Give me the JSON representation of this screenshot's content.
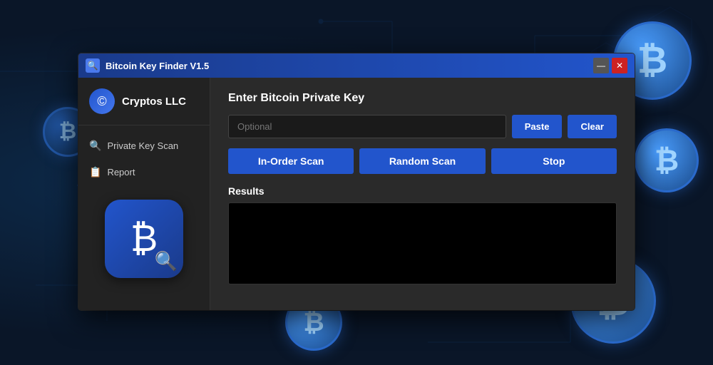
{
  "background": {
    "color": "#0a1628"
  },
  "title_bar": {
    "icon": "🔍",
    "title": "Bitcoin Key Finder V1.5",
    "minimize_label": "—",
    "close_label": "✕"
  },
  "sidebar": {
    "logo_text": "Cryptos LLC",
    "logo_icon": "©",
    "items": [
      {
        "id": "private-key-scan",
        "icon": "🔍",
        "label": "Private Key Scan"
      },
      {
        "id": "report",
        "icon": "📋",
        "label": "Report"
      }
    ]
  },
  "main": {
    "enter_key_title": "Enter Bitcoin Private Key",
    "input_placeholder": "Optional",
    "paste_label": "Paste",
    "clear_label": "Clear",
    "in_order_scan_label": "In-Order Scan",
    "random_scan_label": "Random Scan",
    "stop_label": "Stop",
    "results_title": "Results"
  },
  "coins": [
    {
      "id": "top-right",
      "symbol": "₿"
    },
    {
      "id": "mid-right",
      "symbol": "₿"
    },
    {
      "id": "bottom-right",
      "symbol": "₿"
    },
    {
      "id": "bottom-left",
      "symbol": "₿"
    },
    {
      "id": "mid-left",
      "symbol": "₿"
    }
  ]
}
